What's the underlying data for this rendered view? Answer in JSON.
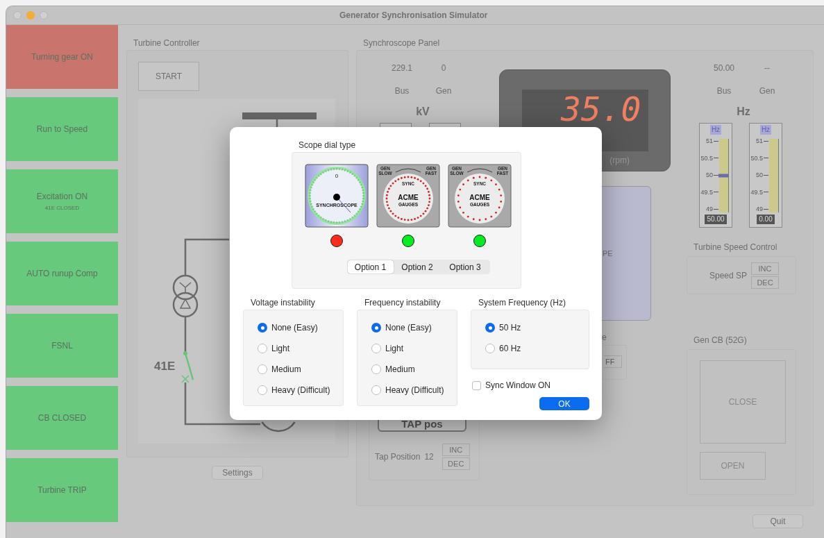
{
  "window": {
    "title": "Generator Synchronisation Simulator"
  },
  "sidebar": {
    "buttons": [
      {
        "label": "Turning gear ON",
        "color": "#c9756d"
      },
      {
        "label": "Run to Speed",
        "color": "#66c97c"
      },
      {
        "label": "Excitation ON",
        "sublabel": "41E CLOSED",
        "color": "#66c97c"
      },
      {
        "label": "AUTO runup Comp",
        "color": "#66c97c"
      },
      {
        "label": "FSNL",
        "color": "#66c97c"
      },
      {
        "label": "CB CLOSED",
        "color": "#66c97c"
      },
      {
        "label": "Turbine TRIP",
        "color": "#66c97c"
      }
    ]
  },
  "turbine_controller": {
    "title": "Turbine Controller",
    "start_button": "START",
    "switch_label": "41E",
    "settings_button": "Settings"
  },
  "synchroscope_panel": {
    "title": "Synchroscope Panel",
    "kv": {
      "bus_value": "229.1",
      "gen_value": "0",
      "bus_label": "Bus",
      "gen_label": "Gen",
      "unit": "kV"
    },
    "speed_display": {
      "reading": "35.0",
      "unit": "(rpm)"
    },
    "scope_label": "PE",
    "hz": {
      "bus_value": "50.00",
      "gen_value": "--",
      "bus_label": "Bus",
      "gen_label": "Gen",
      "unit": "Hz",
      "gauges": [
        {
          "label": "Hz",
          "ticks": [
            "51",
            "50.5",
            "50",
            "49.5",
            "49"
          ],
          "readout": "50.00",
          "level": 0.5
        },
        {
          "label": "Hz",
          "ticks": [
            "51",
            "50.5",
            "50",
            "49.5",
            "49"
          ],
          "readout": "0.00"
        }
      ]
    },
    "turbine_speed_control": {
      "title": "Turbine Speed Control",
      "label": "Speed SP",
      "buttons": [
        "INC",
        "DEC"
      ]
    },
    "partial_panel": {
      "title": "e",
      "button": "FF"
    },
    "tap": {
      "button": "TAP pos",
      "label": "Tap Position",
      "value": "12",
      "buttons": [
        "INC",
        "DEC"
      ]
    },
    "gen_cb": {
      "title": "Gen CB (52G)",
      "buttons": [
        "CLOSE",
        "OPEN"
      ]
    }
  },
  "quit_button": "Quit",
  "dialog": {
    "scope_dial": {
      "title": "Scope dial type",
      "dials": [
        {
          "kind": "synchroscope",
          "color": "#ff2a1a",
          "texts": {
            "zero": "0",
            "name": "SYNCHROSCOPE"
          }
        },
        {
          "kind": "acme_dense",
          "color": "#00ee22",
          "texts": {
            "left": [
              "GEN",
              "SLOW"
            ],
            "right": [
              "GEN",
              "FAST"
            ],
            "top": "SYNC",
            "brand": "ACME",
            "sub": "GAUGES"
          }
        },
        {
          "kind": "acme_sparse",
          "color": "#00ee22",
          "texts": {
            "left": [
              "GEN",
              "SLOW"
            ],
            "right": [
              "GEN",
              "FAST"
            ],
            "top": "SYNC",
            "brand": "ACME",
            "sub": "GAUGES"
          }
        }
      ],
      "options": [
        {
          "label": "Option 1",
          "selected": true
        },
        {
          "label": "Option 2",
          "selected": false
        },
        {
          "label": "Option 3",
          "selected": false
        }
      ]
    },
    "groups": [
      {
        "title": "Voltage instability",
        "options": [
          {
            "label": "None (Easy)",
            "selected": true
          },
          {
            "label": "Light",
            "selected": false
          },
          {
            "label": "Medium",
            "selected": false
          },
          {
            "label": "Heavy (Difficult)",
            "selected": false
          }
        ]
      },
      {
        "title": "Frequency instability",
        "options": [
          {
            "label": "None (Easy)",
            "selected": true
          },
          {
            "label": "Light",
            "selected": false
          },
          {
            "label": "Medium",
            "selected": false
          },
          {
            "label": "Heavy (Difficult)",
            "selected": false
          }
        ]
      },
      {
        "title": "System Frequency (Hz)",
        "options": [
          {
            "label": "50 Hz",
            "selected": true
          },
          {
            "label": "60 Hz",
            "selected": false
          }
        ]
      }
    ],
    "sync_window": {
      "label": "Sync Window ON",
      "checked": false
    },
    "ok_button": "OK"
  }
}
